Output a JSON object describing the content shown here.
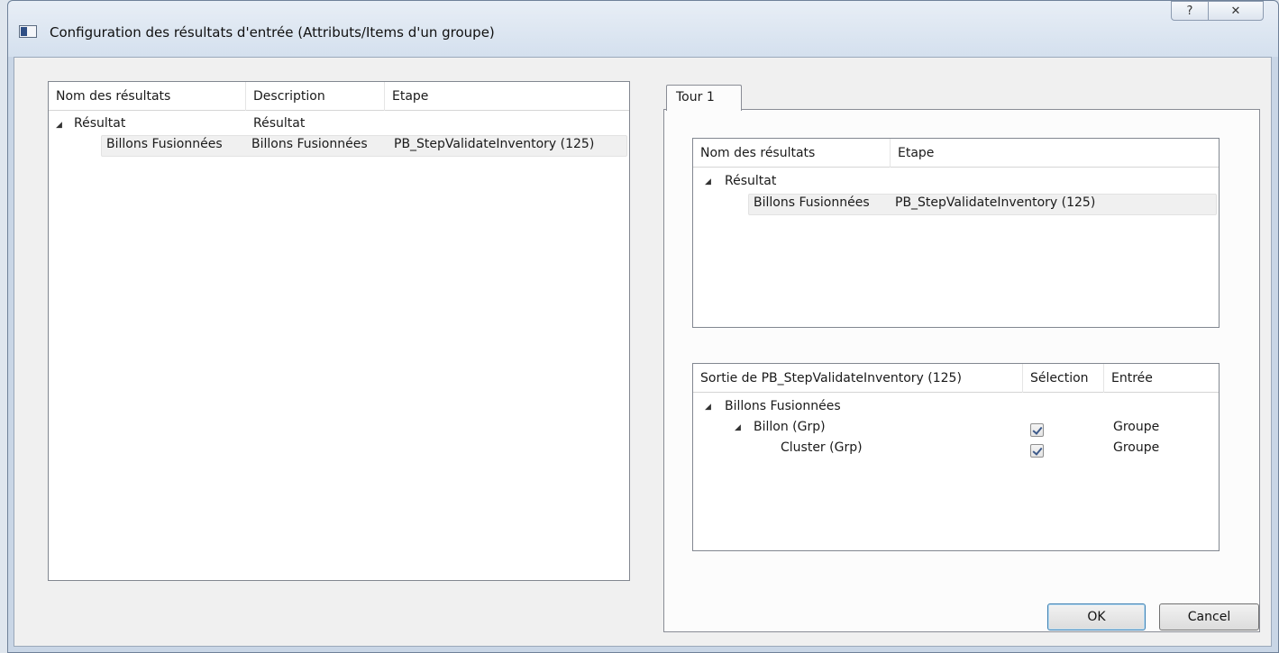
{
  "window": {
    "title": "Configuration des résultats d'entrée (Attributs/Items d'un groupe)",
    "help_glyph": "?",
    "close_glyph": "✕"
  },
  "left_tree": {
    "columns": [
      "Nom des résultats",
      "Description",
      "Etape"
    ],
    "rows": [
      {
        "name": "Résultat",
        "description": "Résultat",
        "step": ""
      },
      {
        "name": "Billons Fusionnées",
        "description": "Billons Fusionnées",
        "step": "PB_StepValidateInventory (125)"
      }
    ]
  },
  "tabs": [
    {
      "label": "Tour 1"
    }
  ],
  "top_right_tree": {
    "columns": [
      "Nom des résultats",
      "Etape"
    ],
    "rows": [
      {
        "name": "Résultat",
        "step": ""
      },
      {
        "name": "Billons Fusionnées",
        "step": "PB_StepValidateInventory (125)"
      }
    ]
  },
  "bottom_right_tree": {
    "columns": [
      "Sortie de PB_StepValidateInventory (125)",
      "Sélection",
      "Entrée"
    ],
    "rows": [
      {
        "name": "Billons Fusionnées",
        "selected": null,
        "input": ""
      },
      {
        "name": "Billon (Grp)",
        "selected": true,
        "input": "Groupe"
      },
      {
        "name": "Cluster (Grp)",
        "selected": true,
        "input": "Groupe"
      }
    ]
  },
  "buttons": {
    "ok": "OK",
    "cancel": "Cancel"
  }
}
